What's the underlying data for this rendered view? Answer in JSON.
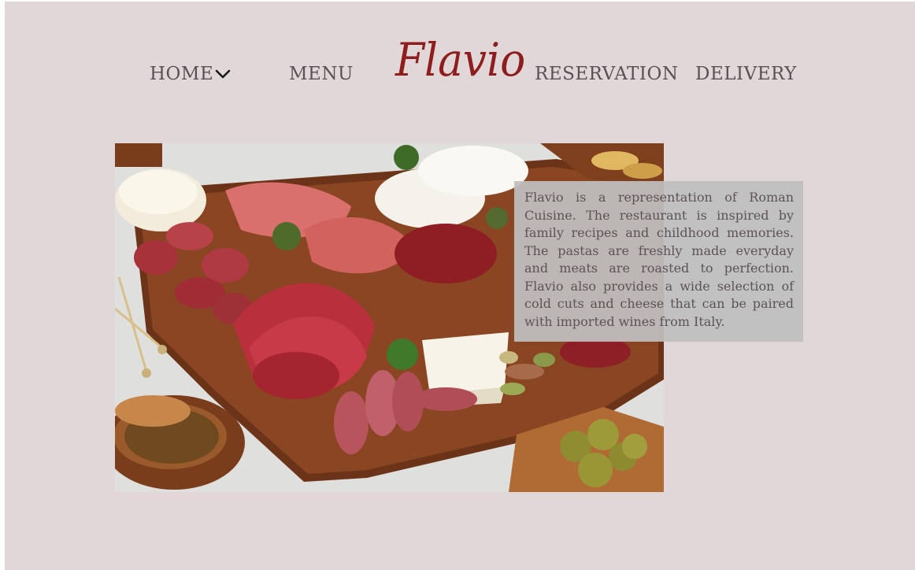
{
  "nav": {
    "home_label": "HOME",
    "menu_label": "MENU",
    "reservation_label": "RESERVATION",
    "delivery_label": "DELIVERY"
  },
  "logo": {
    "text": "Flavio"
  },
  "about": {
    "text": "Flavio is a representation of Roman Cuisine. The restaurant is inspired by family recipes and childhood memories. The pastas are freshly made everyday and meats are roasted to perfection. Flavio also provides a wide selection of cold cuts and cheese that can be paired with imported wines from Italy."
  },
  "colors": {
    "background": "#e1d7d8",
    "nav_text": "#5d4f55",
    "logo": "#8e1e1e",
    "info_box": "#c0c0c0",
    "info_text": "#5c5258"
  },
  "icons": {
    "home_dropdown": "chevron-down-icon"
  },
  "hero_image": {
    "subject": "charcuterie board with cured meats, cheeses, olives and nuts"
  }
}
